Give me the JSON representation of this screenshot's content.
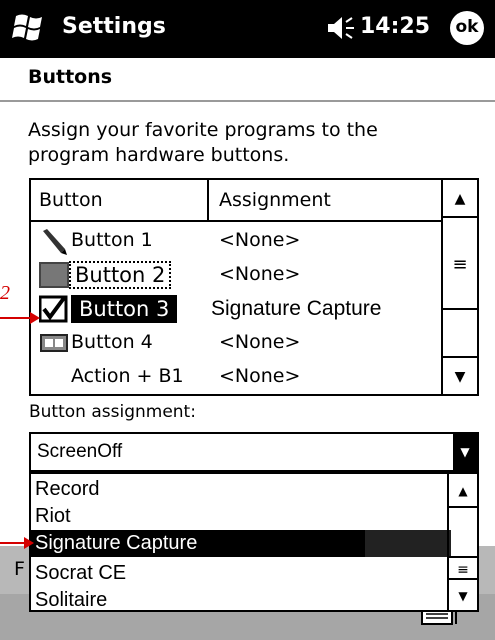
{
  "titlebar": {
    "title": "Settings",
    "time": "14:25",
    "ok_label": "ok"
  },
  "page": {
    "heading": "Buttons",
    "description": "Assign your favorite programs to the program hardware buttons."
  },
  "table": {
    "columns": [
      "Button",
      "Assignment"
    ],
    "rows": [
      {
        "name": "Button 1",
        "assignment": "<None>",
        "icon": "pen-icon"
      },
      {
        "name": "Button 2",
        "assignment": "<None>",
        "icon": "gray-button-icon"
      },
      {
        "name": "Button 3",
        "assignment": "Signature Capture",
        "icon": "checkmark-icon"
      },
      {
        "name": "Button 4",
        "assignment": "<None>",
        "icon": "card-icon"
      },
      {
        "name": "Action + B1",
        "assignment": "<None>",
        "icon": ""
      }
    ]
  },
  "assignment": {
    "label": "Button assignment:",
    "selected": "ScreenOff",
    "options": [
      "Record",
      "Riot",
      "Signature Capture",
      "Socrat CE",
      "Solitaire"
    ],
    "highlighted": "Signature Capture"
  },
  "bottom": {
    "partial_text": "F"
  },
  "callouts": {
    "number": "2"
  },
  "colors": {
    "titlebar": "#000000",
    "callout": "#d40000",
    "bottom_band": "#b8b8b8"
  }
}
